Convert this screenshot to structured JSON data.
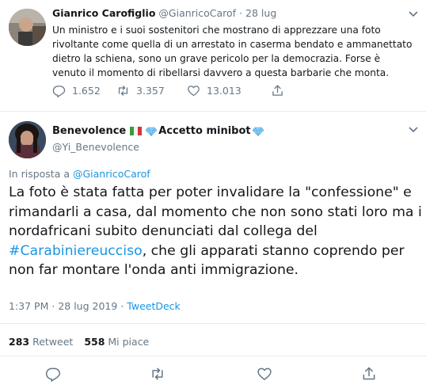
{
  "parent_tweet": {
    "name": "Gianrico Carofiglio",
    "handle": "@GianricoCarof",
    "separator": "·",
    "date": "28 lug",
    "text": "Un ministro e i suoi sostenitori che mostrano di apprezzare una foto rivoltante come quella di un arrestato in caserma bendato e ammanettato dietro la schiena, sono un grave pericolo per la democrazia. Forse è venuto il momento di ribellarsi davvero a questa barbarie che monta.",
    "replies": "1.652",
    "retweets": "3.357",
    "likes": "13.013"
  },
  "reply_tweet": {
    "name_part1": "Benevolence",
    "name_part2": "Accetto minibot",
    "handle": "@Yi_Benevolence",
    "in_reply_label": "In risposta a",
    "in_reply_mention": "@GianricoCarof",
    "text_before": "La foto è stata fatta per poter invalidare la \"confessione\" e rimandarli a casa, dal momento che non sono stati loro ma i nordafricani subito denunciati dal collega del ",
    "hashtag": "#Carabiniereucciso",
    "text_after": ", che gli apparati stanno coprendo per non far montare l'onda anti immigrazione.",
    "time": "1:37 PM",
    "date": "28 lug 2019",
    "separator": "·",
    "source": "TweetDeck",
    "retweet_count": "283",
    "retweet_label": "Retweet",
    "like_count": "558",
    "like_label": "Mi piace"
  },
  "icons": {
    "reply": "reply-icon",
    "retweet": "retweet-icon",
    "like": "heart-icon",
    "share": "share-icon",
    "more": "chevron-down-icon",
    "flag": "italy-flag-icon",
    "diamond": "diamond-icon"
  },
  "colors": {
    "link": "#1b95e0",
    "secondary": "#657786",
    "text": "#14171a",
    "border": "#e6ecf0"
  }
}
